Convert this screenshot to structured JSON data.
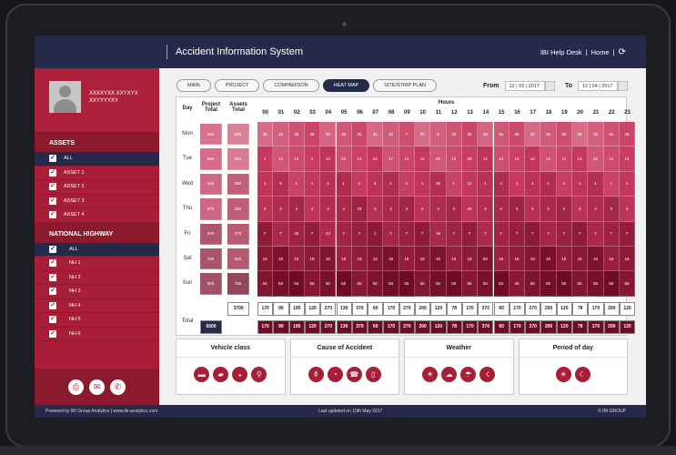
{
  "app": {
    "title": "Accident Information System",
    "help_desk": "IBI Help Desk",
    "home": "Home",
    "divider": "|"
  },
  "user": {
    "name_line1": "XXXXYXX XXYXYX",
    "name_line2": "XXYYYYXY"
  },
  "assets": {
    "heading": "ASSETS",
    "items": [
      "ALL",
      "ASSET 1",
      "ASSET 2",
      "ASSET 3",
      "ASSET 4"
    ]
  },
  "highway": {
    "heading": "NATIONAL HIGHWAY",
    "items": [
      "ALL",
      "NH 1",
      "NH 2",
      "NH 3",
      "NH 4",
      "NH 5",
      "NH 6"
    ]
  },
  "sidebar_icons": [
    "save-icon",
    "mail-icon",
    "phone-icon"
  ],
  "tabs": [
    {
      "label": "MAIN"
    },
    {
      "label": "PROJECT"
    },
    {
      "label": "COMPARISON"
    },
    {
      "label": "HEAT MAP",
      "active": true
    },
    {
      "label": "SITE/STRIP PLAN"
    }
  ],
  "date_range": {
    "from_label": "From",
    "from_value": "12 | 03 | 2017",
    "to_label": "To",
    "to_value": "12 | 04 | 2017"
  },
  "heatmap": {
    "col_day": "Day",
    "col_project": "Project Total",
    "col_assets": "Assets Total",
    "col_hours": "Hours",
    "hours": [
      "00",
      "01",
      "02",
      "03",
      "04",
      "05",
      "06",
      "07",
      "08",
      "09",
      "10",
      "11",
      "12",
      "13",
      "14",
      "15",
      "16",
      "17",
      "18",
      "19",
      "20",
      "21",
      "22",
      "23"
    ],
    "days": [
      "Mon",
      "Tue",
      "Wed",
      "Thu",
      "Fri",
      "Sat",
      "Sun"
    ],
    "project_totals": [
      "440",
      "555",
      "345",
      "670",
      "400",
      "780",
      "890"
    ],
    "asset_totals": [
      "325",
      "551",
      "380",
      "250",
      "276",
      "550",
      "755"
    ],
    "values": [
      [
        "35",
        "35",
        "35",
        "35",
        "35",
        "35",
        "35",
        "35",
        "35",
        "7",
        "35",
        "5",
        "35",
        "35",
        "35",
        "35",
        "35",
        "35",
        "35",
        "35",
        "35",
        "35",
        "35",
        "35"
      ],
      [
        "1",
        "12",
        "15",
        "2",
        "12",
        "12",
        "12",
        "12",
        "17",
        "12",
        "12",
        "29",
        "12",
        "29",
        "12",
        "12",
        "12",
        "12",
        "12",
        "12",
        "12",
        "12",
        "12",
        "12"
      ],
      [
        "1",
        "9",
        "1",
        "1",
        "1",
        "1",
        "1",
        "6",
        "1",
        "1",
        "1",
        "35",
        "1",
        "12",
        "1",
        "4",
        "1",
        "1",
        "1",
        "1",
        "1",
        "1",
        "1",
        "1"
      ],
      [
        "3",
        "3",
        "3",
        "3",
        "3",
        "3",
        "23",
        "3",
        "3",
        "3",
        "3",
        "3",
        "3",
        "40",
        "3",
        "3",
        "3",
        "3",
        "3",
        "3",
        "3",
        "3",
        "3",
        "3"
      ],
      [
        "7",
        "7",
        "30",
        "7",
        "24",
        "7",
        "7",
        "1",
        "7",
        "7",
        "7",
        "16",
        "7",
        "7",
        "7",
        "7",
        "7",
        "7",
        "7",
        "7",
        "7",
        "7",
        "7",
        "7"
      ],
      [
        "18",
        "18",
        "18",
        "18",
        "18",
        "18",
        "18",
        "18",
        "18",
        "18",
        "18",
        "18",
        "18",
        "18",
        "55",
        "18",
        "18",
        "18",
        "18",
        "18",
        "18",
        "18",
        "18",
        "18"
      ],
      [
        "55",
        "55",
        "55",
        "55",
        "55",
        "55",
        "55",
        "55",
        "55",
        "55",
        "55",
        "55",
        "55",
        "55",
        "55",
        "55",
        "45",
        "55",
        "55",
        "55",
        "55",
        "55",
        "55",
        "55"
      ]
    ],
    "total_label": "Total",
    "assets_total_sum": "3700",
    "project_total_sum": "6500",
    "hour_totals": [
      "170",
      "90",
      "195",
      "120",
      "270",
      "130",
      "370",
      "60",
      "170",
      "270",
      "200",
      "120",
      "78",
      "170",
      "370",
      "60",
      "170",
      "270",
      "200",
      "120",
      "78",
      "170",
      "200",
      "120"
    ],
    "colors": {
      "low": "#e8a2b4",
      "mid": "#c6385d",
      "high": "#6e0c24"
    }
  },
  "filters": [
    {
      "title": "Vehicle class",
      "icons": [
        "bus-icon",
        "truck-icon",
        "car-icon",
        "motorbike-icon"
      ]
    },
    {
      "title": "Cause of Accident",
      "icons": [
        "bottle-icon",
        "speed-icon",
        "phone-hand-icon",
        "mobile-icon"
      ]
    },
    {
      "title": "Weather",
      "icons": [
        "sun-icon",
        "cloud-icon",
        "rain-icon",
        "storm-icon"
      ]
    },
    {
      "title": "Period of day",
      "icons": [
        "day-icon",
        "night-icon"
      ]
    }
  ],
  "footer": {
    "powered": "Powered by IBI Group Analytics | www.ibi-analytics.com",
    "updated": "Last updated on 10th May 2017",
    "copyright": "© IBI GROUP"
  }
}
